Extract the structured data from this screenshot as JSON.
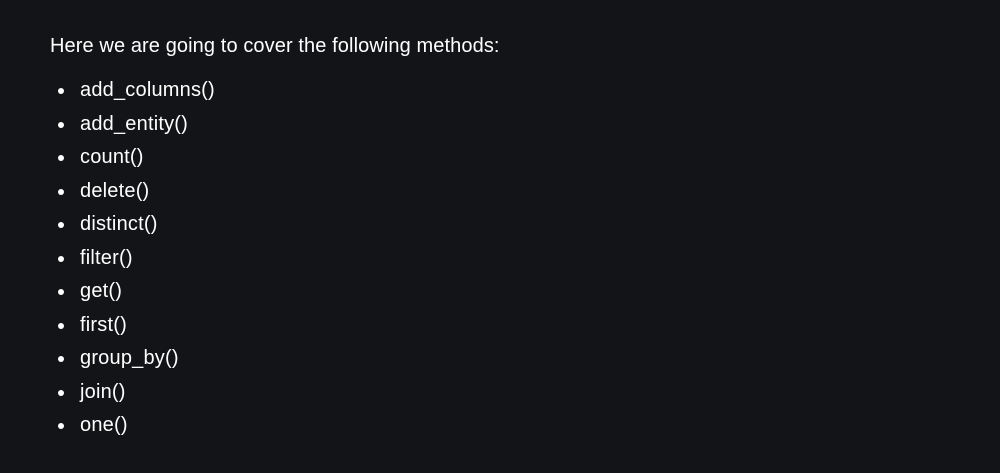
{
  "intro": "Here we are going to cover the following methods:",
  "methods": [
    "add_columns()",
    "add_entity()",
    "count()",
    "delete()",
    "distinct()",
    "filter()",
    "get()",
    "first()",
    "group_by()",
    "join()",
    "one()"
  ],
  "colors": {
    "background": "#131417",
    "text": "#ffffff"
  }
}
